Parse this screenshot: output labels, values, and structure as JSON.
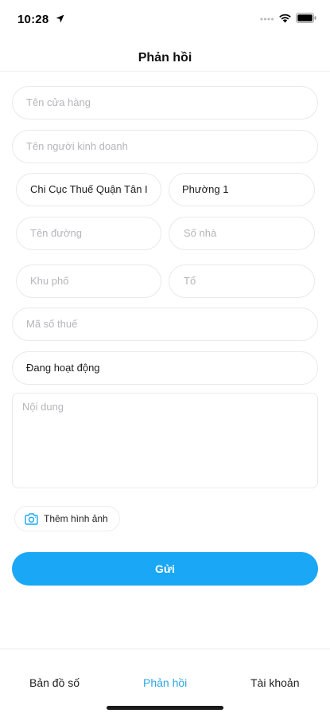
{
  "status_bar": {
    "time": "10:28"
  },
  "header": {
    "title": "Phản hồi"
  },
  "form": {
    "store_name": {
      "placeholder": "Tên cửa hàng"
    },
    "owner_name": {
      "placeholder": "Tên người kinh doanh"
    },
    "tax_office": {
      "value": "Chi Cục Thuế Quận Tân I"
    },
    "ward": {
      "value": "Phường 1"
    },
    "street": {
      "placeholder": "Tên đường"
    },
    "house_number": {
      "placeholder": "Số nhà"
    },
    "quarter": {
      "placeholder": "Khu phố"
    },
    "group": {
      "placeholder": "Tổ"
    },
    "tax_code": {
      "placeholder": "Mã số thuế"
    },
    "status": {
      "value": "Đang hoạt động"
    },
    "content": {
      "placeholder": "Nội dung"
    },
    "add_image_label": "Thêm hình ảnh",
    "submit_label": "Gửi"
  },
  "tab_bar": {
    "tabs": [
      {
        "label": "Bản đồ số",
        "active": false
      },
      {
        "label": "Phản hồi",
        "active": true
      },
      {
        "label": "Tài khoản",
        "active": false
      }
    ]
  },
  "colors": {
    "accent": "#1aa7f5",
    "active_tab": "#2ba6e6"
  },
  "icons": [
    "location-arrow-icon",
    "signal-icon",
    "wifi-icon",
    "battery-icon",
    "camera-icon"
  ]
}
